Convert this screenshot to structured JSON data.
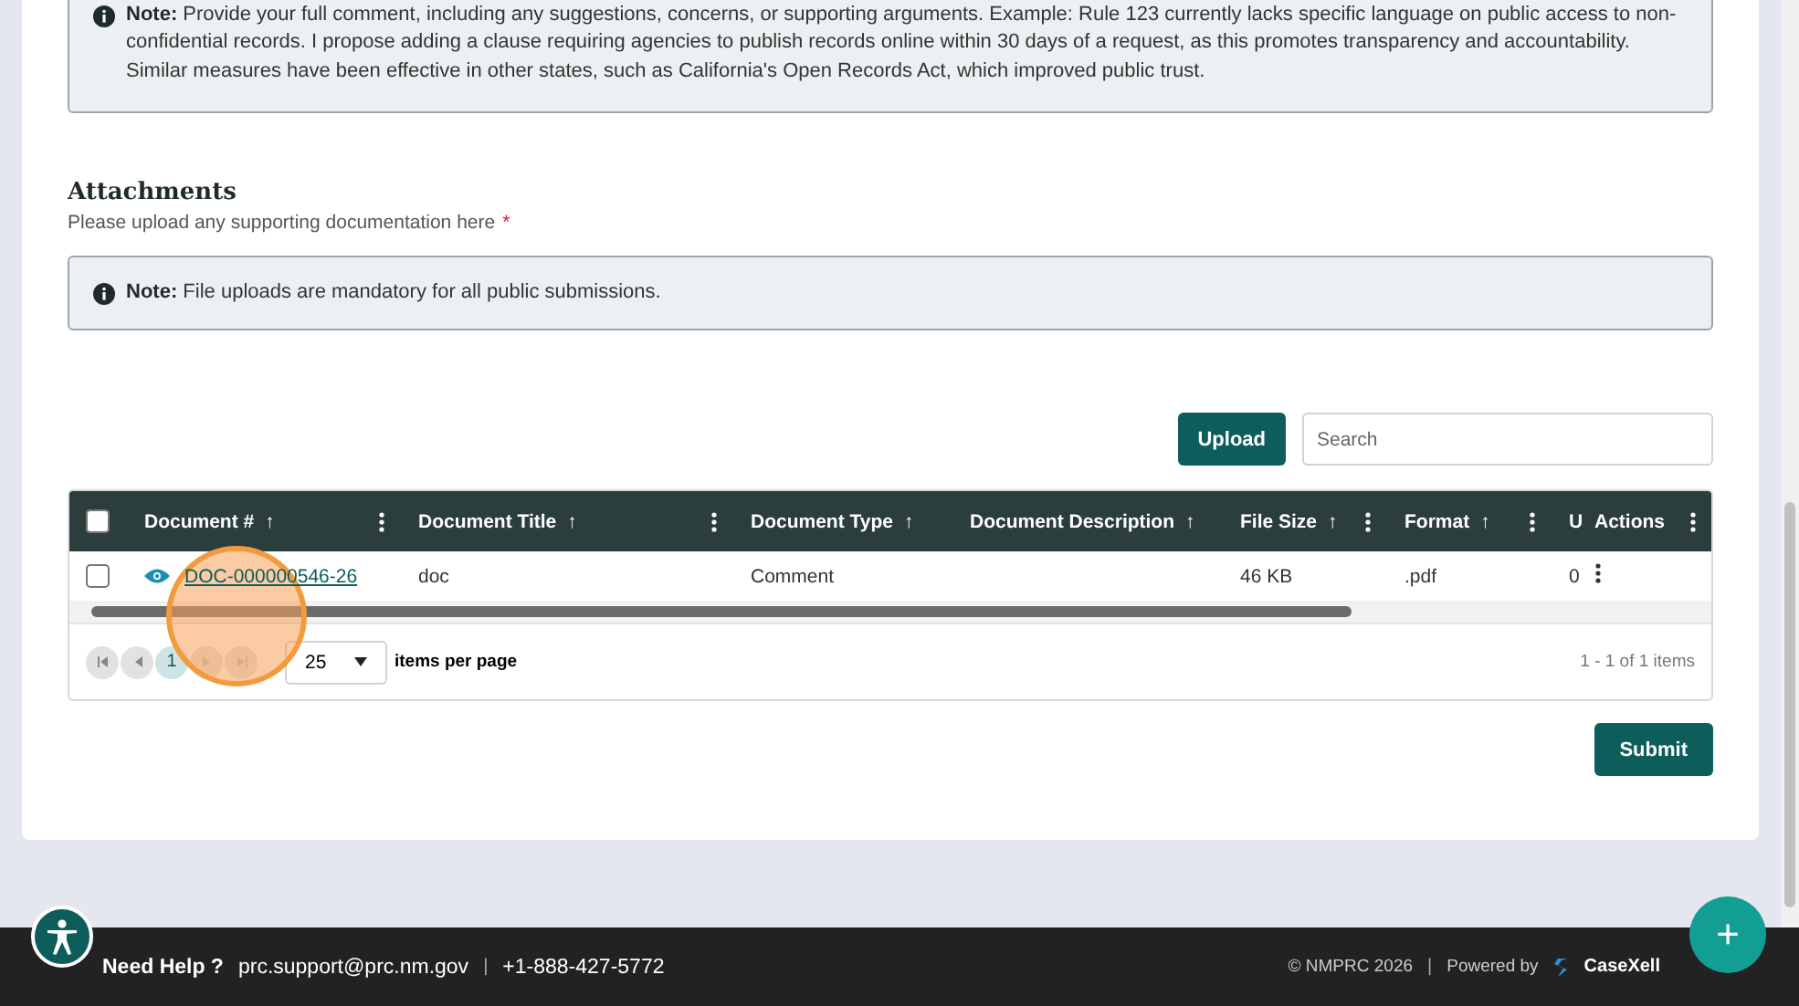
{
  "comment_note": {
    "label": "Note:",
    "text": "Provide your full comment, including any suggestions, concerns, or supporting arguments. Example: Rule 123 currently lacks specific language on public access to non-confidential records. I propose adding a clause requiring agencies to publish records online within 30 days of a request, as this promotes transparency and accountability. Similar measures have been effective in other states, such as California's Open Records Act, which improved public trust."
  },
  "attachments": {
    "title": "Attachments",
    "hint": "Please upload any supporting documentation here",
    "required_mark": "*",
    "note": {
      "label": "Note:",
      "text": "File uploads are mandatory for all public submissions."
    },
    "upload_button": "Upload",
    "search": {
      "placeholder": "Search"
    },
    "table": {
      "select_all_checked": false,
      "columns": [
        {
          "label": "Document #",
          "sort": "↑",
          "menu": true
        },
        {
          "label": "Document Title",
          "sort": "↑",
          "menu": true
        },
        {
          "label": "Document Type",
          "sort": "↑",
          "menu": false
        },
        {
          "label": "Document Description",
          "sort": "↑",
          "menu": false
        },
        {
          "label": "File Size",
          "sort": "↑",
          "menu": true
        },
        {
          "label": "Format",
          "sort": "↑",
          "menu": true
        },
        {
          "label": "U"
        },
        {
          "label": "Actions",
          "menu": true
        }
      ],
      "rows": [
        {
          "checked": false,
          "cells": [
            "DOC-000000546-26",
            "doc",
            "Comment",
            "",
            "46 KB",
            ".pdf",
            "0"
          ]
        }
      ]
    },
    "pager": {
      "pages": [
        {
          "label": "1",
          "selected": true
        }
      ],
      "page_size": "25",
      "page_size_label": "items per page",
      "summary": "1 - 1 of 1 items"
    },
    "submit_button": "Submit"
  },
  "footer": {
    "help_label": "Need Help ?",
    "email": "prc.support@prc.nm.gov",
    "separator": "|",
    "phone": "+1-888-427-5772",
    "copyright": "© NMPRC 2026",
    "separator_2": "|",
    "powered_by": "Powered by",
    "brand": "CaseXell"
  },
  "fab": "+"
}
